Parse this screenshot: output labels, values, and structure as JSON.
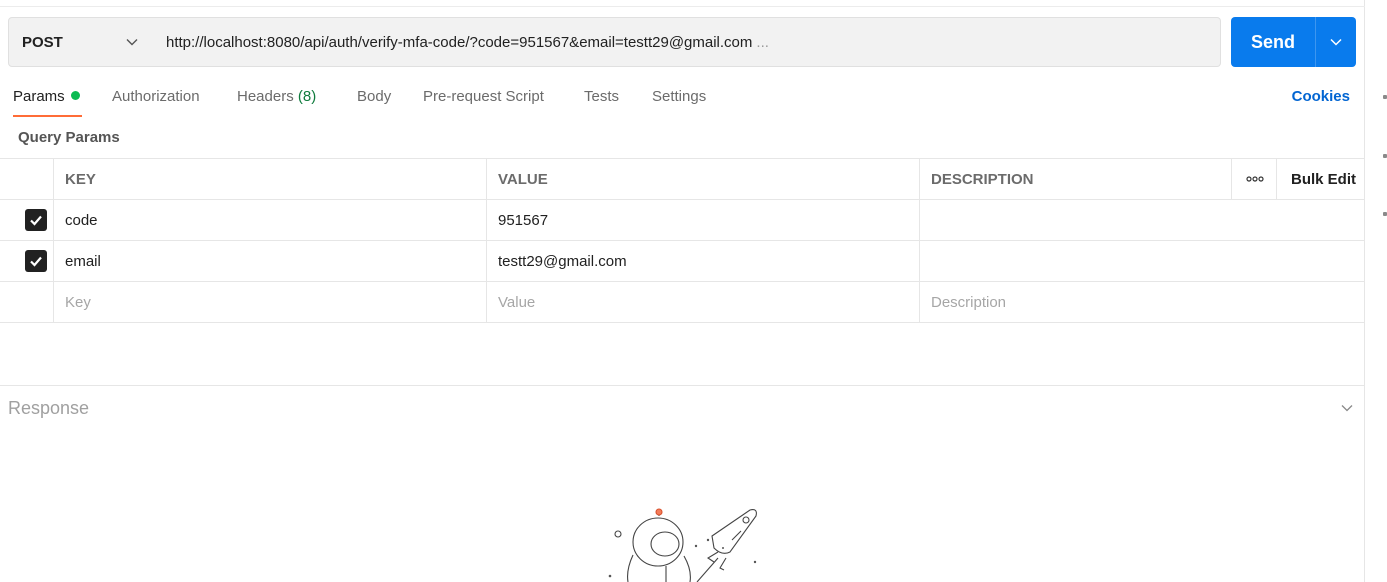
{
  "request": {
    "method": "POST",
    "url": "http://localhost:8080/api/auth/verify-mfa-code/?code=951567&email=testt29@gmail.com",
    "url_overflow": "...",
    "send_label": "Send"
  },
  "tabs": [
    {
      "label": "Params"
    },
    {
      "label": "Authorization"
    },
    {
      "label": "Headers",
      "count": "(8)"
    },
    {
      "label": "Body"
    },
    {
      "label": "Pre-request Script"
    },
    {
      "label": "Tests"
    },
    {
      "label": "Settings"
    }
  ],
  "cookies_label": "Cookies",
  "query_params": {
    "title": "Query Params",
    "headers": {
      "key": "KEY",
      "value": "VALUE",
      "description": "DESCRIPTION",
      "bulk_edit": "Bulk Edit"
    },
    "rows": [
      {
        "checked": true,
        "key": "code",
        "value": "951567",
        "description": ""
      },
      {
        "checked": true,
        "key": "email",
        "value": "testt29@gmail.com",
        "description": ""
      }
    ],
    "placeholders": {
      "key": "Key",
      "value": "Value",
      "description": "Description"
    }
  },
  "response": {
    "title": "Response"
  },
  "colors": {
    "accent": "#ff6c37",
    "send": "#097bed",
    "link": "#0265d2",
    "params_dot": "#0cbb52",
    "count": "#0f7b3d"
  },
  "icons": [
    "chevron-down-icon",
    "more-icon",
    "checkbox-icon",
    "astronaut-illustration"
  ]
}
